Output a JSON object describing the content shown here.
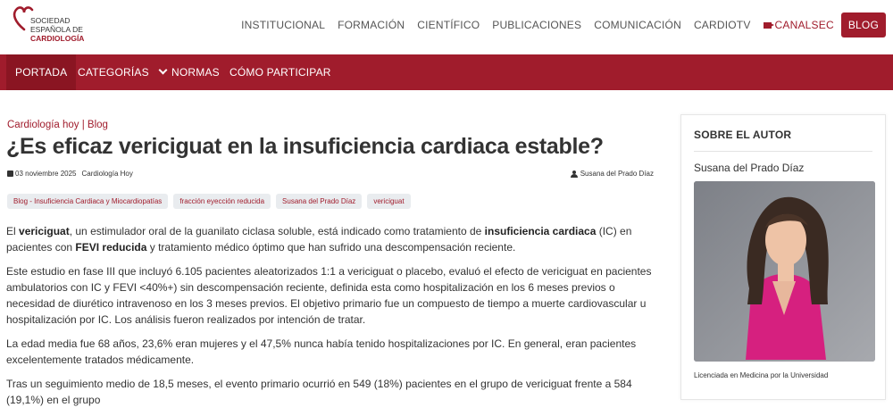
{
  "logo": {
    "line1": "SOCIEDAD",
    "line2": "ESPAÑOLA DE",
    "line3": "CARDIOLOGÍA"
  },
  "topnav": {
    "items": [
      "INSTITUCIONAL",
      "FORMACIÓN",
      "CIENTÍFICO",
      "PUBLICACIONES",
      "COMUNICACIÓN",
      "CARDIOTV"
    ],
    "canal": "CANALSEC",
    "blog": "BLOG"
  },
  "subnav": {
    "portada": "PORTADA",
    "categorias": "CATEGORÍAS",
    "normas": "NORMAS",
    "participar": "CÓMO PARTICIPAR"
  },
  "article": {
    "breadcrumb": "Cardiología hoy | Blog",
    "title": "¿Es eficaz vericiguat en la insuficiencia cardiaca estable?",
    "date": "03 noviembre 2025",
    "category": "Cardiología Hoy",
    "author": "Susana del Prado Díaz",
    "tags": [
      "Blog - Insuficiencia Cardiaca y Miocardiopatías",
      "fracción eyección reducida",
      "Susana del Prado Díaz",
      "vericiguat"
    ],
    "p1": {
      "a": "El ",
      "b": "vericiguat",
      "c": ", un estimulador oral de la guanilato ciclasa soluble, está indicado como tratamiento de ",
      "d": "insuficiencia cardiaca",
      "e": " (IC) en pacientes con ",
      "f": "FEVI reducida",
      "g": " y tratamiento médico óptimo que han sufrido una descompensación reciente."
    },
    "p2": "Este estudio en fase III que incluyó 6.105 pacientes aleatorizados 1:1 a vericiguat o placebo, evaluó el efecto de vericiguat en pacientes ambulatorios con IC y FEVI <40%+) sin descompensación reciente, definida esta como hospitalización en los 6 meses previos o necesidad de diurético intravenoso en los 3 meses previos. El objetivo primario fue un compuesto de tiempo a muerte cardiovascular u hospitalización por IC. Los análisis fueron realizados por intención de tratar.",
    "p3": "La edad media fue 68 años, 23,6% eran mujeres y el 47,5% nunca había tenido hospitalizaciones por IC. En general, eran pacientes excelentemente tratados médicamente.",
    "p4": "Tras un seguimiento medio de 18,5 meses, el evento primario ocurrió en 549 (18%) pacientes en el grupo de vericiguat frente a 584 (19,1%) en el grupo"
  },
  "sidebar": {
    "heading": "SOBRE EL AUTOR",
    "name": "Susana del Prado Díaz",
    "bio": "Licenciada en Medicina por la Universidad"
  },
  "colors": {
    "brand": "#a01c2c",
    "band_active": "#8a1522",
    "tag_bg": "#e9ecef",
    "photo_top": "#2a2c31",
    "photo_dress": "#d6207f"
  },
  "icons": [
    "heart-logo-icon",
    "camera-icon",
    "chevron-down-icon",
    "calendar-icon",
    "user-icon"
  ]
}
